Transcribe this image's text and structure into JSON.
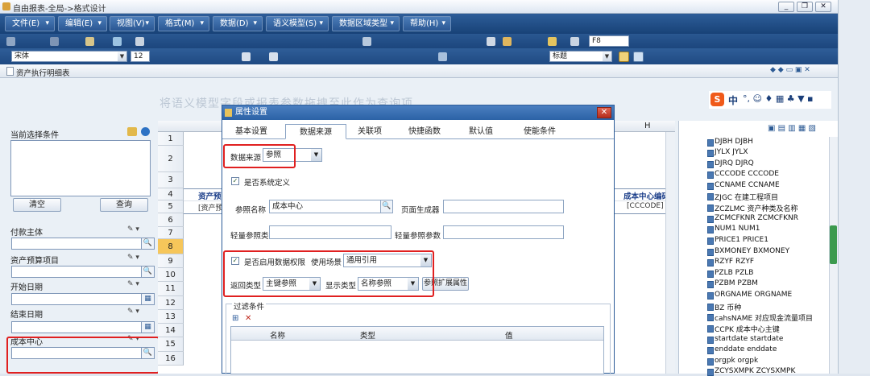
{
  "window": {
    "title": "自由报表-全局->格式设计"
  },
  "menus": [
    "文件(E)",
    "编辑(E)",
    "视图(V)",
    "格式(M)",
    "数据(D)",
    "语义模型(S)",
    "数据区域类型",
    "帮助(H)"
  ],
  "toolbar": {
    "find_value": "F8",
    "font": "宋体",
    "size": "12",
    "style": "标题"
  },
  "doc_tab": "资产执行明细表",
  "hint": "将语义模型字段或报表参数拖拽至此作为查询项",
  "left": {
    "conditions_title": "当前选择条件",
    "clear": "清空",
    "query": "查询",
    "fields": [
      "付款主体",
      "资产预算项目",
      "开始日期",
      "结束日期",
      "成本中心"
    ]
  },
  "grid": {
    "col_h": "H",
    "rows": [
      "1",
      "2",
      "3",
      "4",
      "5",
      "6",
      "7",
      "8",
      "9",
      "10",
      "11",
      "12",
      "13",
      "14",
      "15",
      "16"
    ],
    "cell_4b": "资产预",
    "cell_5b": "[资产预",
    "cell_4h": "成本中心编码",
    "cell_5h": "[CCCODE]"
  },
  "dialog": {
    "title": "属性设置",
    "tabs": [
      "基本设置",
      "数据来源",
      "关联项",
      "快捷函数",
      "默认值",
      "使能条件"
    ],
    "source_label": "数据来源",
    "source_value": "参照",
    "is_system": "是否系统定义",
    "ref_name_label": "参照名称",
    "ref_name_value": "成本中心",
    "page_gen_label": "页面生成器",
    "light_ref_class": "轻量参照类",
    "light_ref_param": "轻量参照参数",
    "enable_perm": "是否启用数据权限",
    "scene_label": "使用场景",
    "scene_value": "通用引用",
    "return_label": "返回类型",
    "return_value": "主键参照",
    "display_label": "显示类型",
    "display_value": "名称参照",
    "ext_button": "参照扩展属性",
    "filter_title": "过滤条件",
    "cols": [
      "名称",
      "类型",
      "值"
    ]
  },
  "tree": [
    "DJBH DJBH",
    "JYLX JYLX",
    "DJRQ DJRQ",
    "CCCODE CCCODE",
    "CCNAME CCNAME",
    "ZJGC 在建工程项目",
    "ZCZLMC 资产种类及名称",
    "ZCMCFKNR ZCMCFKNR",
    "NUM1 NUM1",
    "PRICE1 PRICE1",
    "BXMONEY BXMONEY",
    "RZYF RZYF",
    "PZLB PZLB",
    "PZBM PZBM",
    "ORGNAME ORGNAME",
    "BZ 币种",
    "cahsNAME 对应现金流量项目",
    "CCPK 成本中心主键",
    "startdate startdate",
    "enddate enddate",
    "orgpk orgpk",
    "ZCYSXMPK ZCYSXMPK"
  ],
  "ime_label": "中",
  "colors": {
    "menubar": "#1f4a82",
    "dialog_title": "#2b62a6",
    "highlight": "#e02020"
  }
}
